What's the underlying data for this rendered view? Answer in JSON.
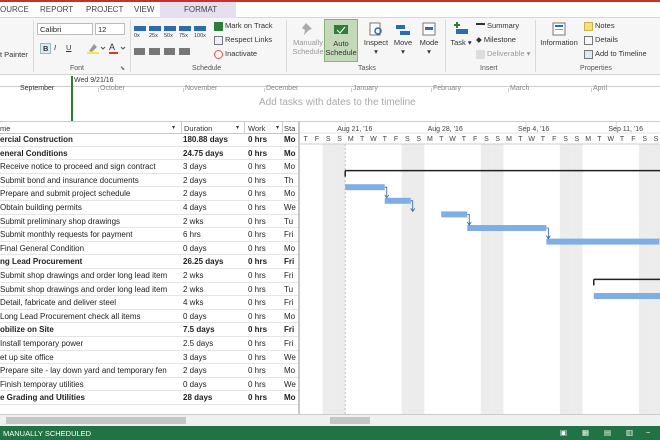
{
  "tabs": [
    "OURCE",
    "REPORT",
    "PROJECT",
    "VIEW",
    "FORMAT"
  ],
  "ribbon": {
    "painter": "t Painter",
    "font_name": "Calibri",
    "font_size": "12",
    "font_group": "Font",
    "schedule_group": "Schedule",
    "mark_on_track": "Mark on Track",
    "respect_links": "Respect Links",
    "inactivate": "Inactivate",
    "manually_schedule": [
      "Manually",
      "Schedule"
    ],
    "auto_schedule": [
      "Auto",
      "Schedule"
    ],
    "inspect": "Inspect",
    "move": "Move",
    "mode": "Mode",
    "tasks_group": "Tasks",
    "task": "Task",
    "summary": "Summary",
    "milestone": "Milestone",
    "deliverable": "Deliverable",
    "insert_group": "Insert",
    "information": "Information",
    "notes": "Notes",
    "details": "Details",
    "add_to_timeline": "Add to Timeline",
    "properties_group": "Properties"
  },
  "timeline": {
    "today": "Wed 9/21/16",
    "months": [
      "September",
      "October",
      "November",
      "December",
      "January",
      "February",
      "March",
      "April"
    ],
    "placeholder": "Add tasks with dates to the timeline"
  },
  "grid": {
    "headers": {
      "name": "me",
      "duration": "Duration",
      "work": "Work",
      "start": "Sta"
    },
    "rows": [
      {
        "name": "ercial Construction",
        "duration": "180.88 days",
        "work": "0 hrs",
        "start": "Mo",
        "bold": true
      },
      {
        "name": "eneral Conditions",
        "duration": "24.75 days",
        "work": "0 hrs",
        "start": "Mo",
        "bold": true
      },
      {
        "name": "Receive notice to proceed and sign contract",
        "duration": "3 days",
        "work": "0 hrs",
        "start": "Mo"
      },
      {
        "name": "Submit bond and insurance documents",
        "duration": "2 days",
        "work": "0 hrs",
        "start": "Th"
      },
      {
        "name": "Prepare and submit project schedule",
        "duration": "2 days",
        "work": "0 hrs",
        "start": "Mo"
      },
      {
        "name": "Obtain building permits",
        "duration": "4 days",
        "work": "0 hrs",
        "start": "We"
      },
      {
        "name": "Submit preliminary shop drawings",
        "duration": "2 wks",
        "work": "0 hrs",
        "start": "Tu"
      },
      {
        "name": "Submit monthly requests for payment",
        "duration": "6 hrs",
        "work": "0 hrs",
        "start": "Fri"
      },
      {
        "name": "Final General Condition",
        "duration": "0 days",
        "work": "0 hrs",
        "start": "Mo"
      },
      {
        "name": "ng Lead Procurement",
        "duration": "26.25 days",
        "work": "0 hrs",
        "start": "Fri",
        "bold": true
      },
      {
        "name": "Submit shop drawings and order long lead item",
        "duration": "2 wks",
        "work": "0 hrs",
        "start": "Fri"
      },
      {
        "name": "Submit shop drawings and order long lead item",
        "duration": "2 wks",
        "work": "0 hrs",
        "start": "Tu"
      },
      {
        "name": "Detail, fabricate and deliver steel",
        "duration": "4 wks",
        "work": "0 hrs",
        "start": "Fri"
      },
      {
        "name": "Long Lead Procurement check all items",
        "duration": "0 days",
        "work": "0 hrs",
        "start": "Mo"
      },
      {
        "name": "obilize on Site",
        "duration": "7.5 days",
        "work": "0 hrs",
        "start": "Fri",
        "bold": true
      },
      {
        "name": "Install temporary power",
        "duration": "2.5 days",
        "work": "0 hrs",
        "start": "Fri"
      },
      {
        "name": "et up site office",
        "duration": "3 days",
        "work": "0 hrs",
        "start": "We"
      },
      {
        "name": "Prepare site - lay down yard and temporary fen",
        "duration": "2 days",
        "work": "0 hrs",
        "start": "Mo"
      },
      {
        "name": "Finish temporay utilities",
        "duration": "0 days",
        "work": "0 hrs",
        "start": "We"
      },
      {
        "name": "e Grading and Utilities",
        "duration": "28 days",
        "work": "0 hrs",
        "start": "Mo",
        "bold": true
      }
    ]
  },
  "gantt": {
    "weeks": [
      "Aug 21, '16",
      "Aug 28, '16",
      "Sep 4, '16",
      "Sep 11, '16"
    ],
    "days": [
      "T",
      "F",
      "S",
      "S",
      "M",
      "T",
      "W",
      "T",
      "F",
      "S",
      "S",
      "M",
      "T",
      "W",
      "T",
      "F",
      "S",
      "S",
      "M",
      "T",
      "W",
      "T",
      "F",
      "S",
      "S",
      "M",
      "T",
      "W",
      "T",
      "F",
      "S",
      "S",
      "M",
      "T",
      "W",
      "T",
      "F",
      "S",
      "S",
      "M"
    ]
  },
  "status": {
    "text": "MANUALLY SCHEDULED"
  },
  "colors": {
    "accent": "#217346",
    "bar": "#7eaee5",
    "summary": "#222222",
    "weekend": "#ececec"
  }
}
